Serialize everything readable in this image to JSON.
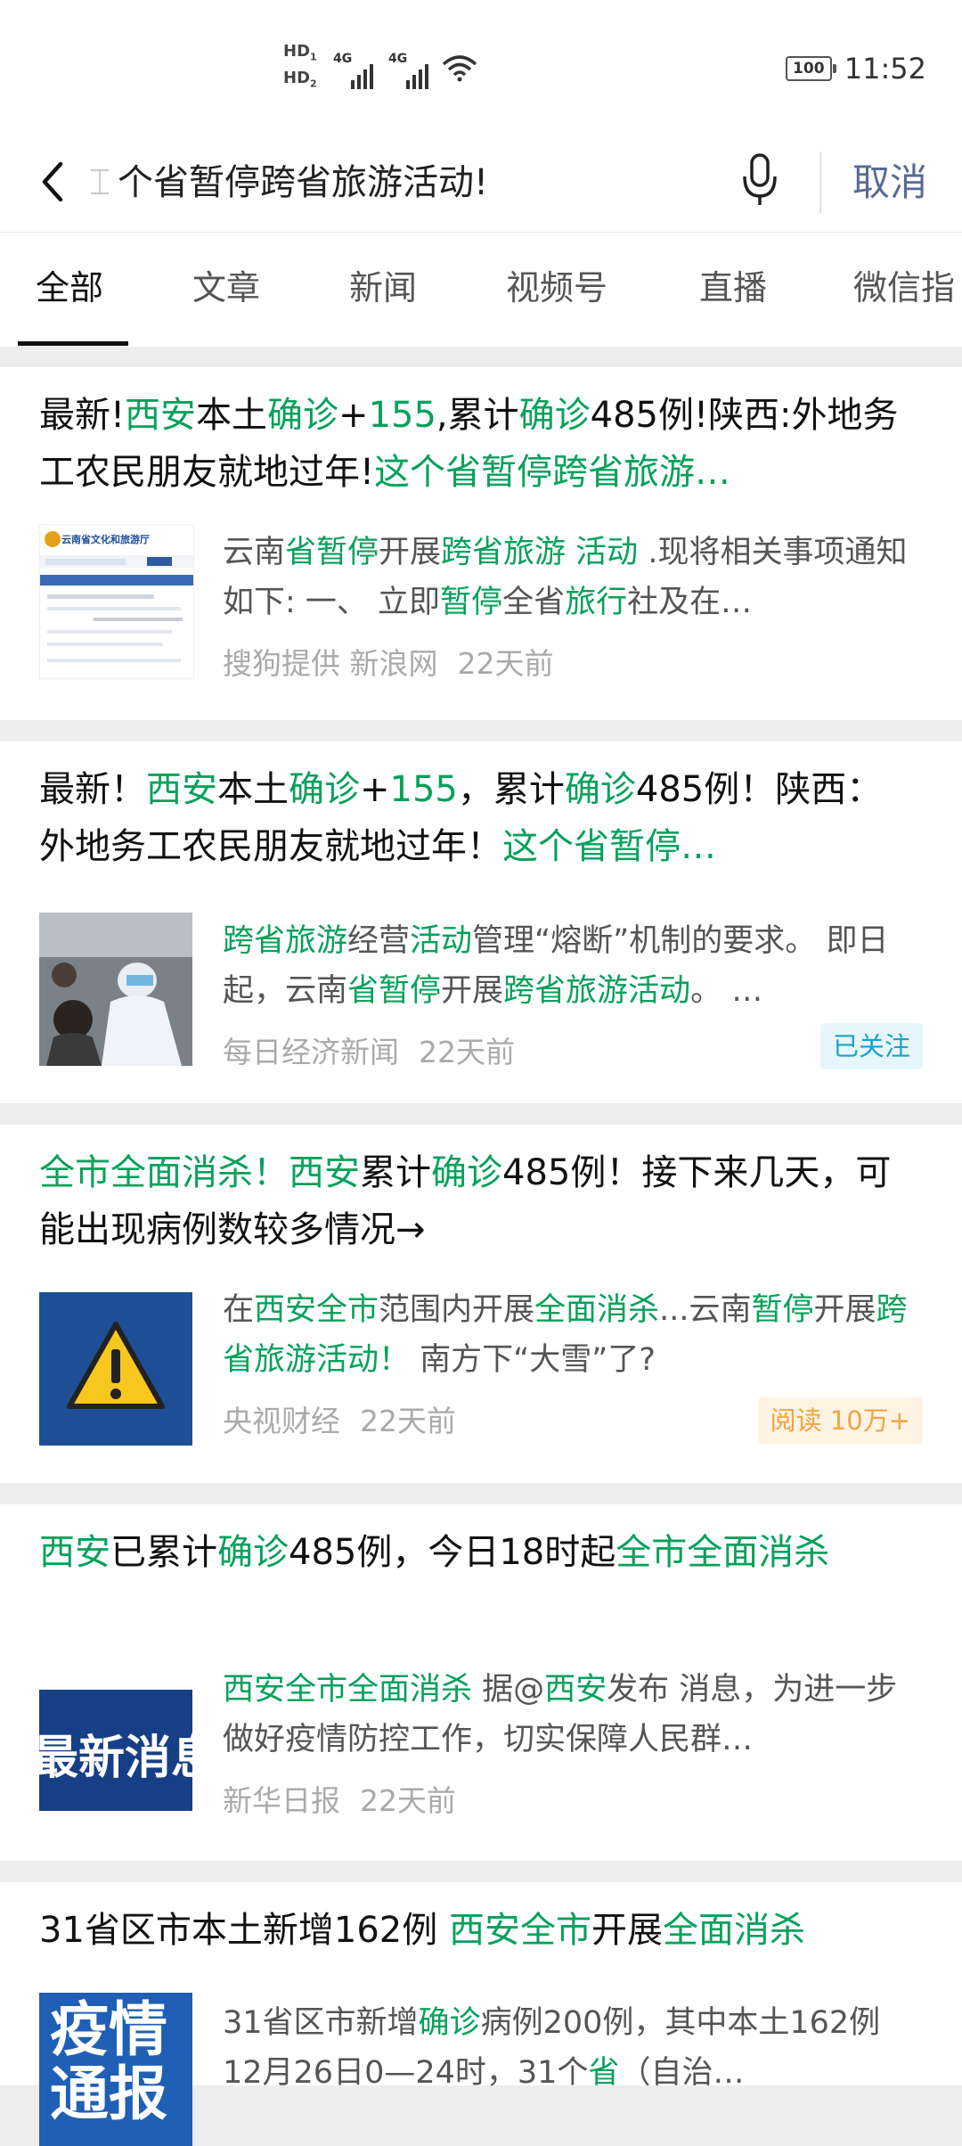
{
  "status_bar": {
    "hd1": "HD",
    "hd1_sub": "1",
    "hd2": "HD",
    "hd2_sub": "2",
    "net1": "4G",
    "net2": "4G",
    "battery": "100",
    "time": "11:52"
  },
  "search": {
    "query_text": "个省暂停跨省旅游活动!",
    "cancel_label": "取消"
  },
  "tabs": [
    {
      "label": "全部",
      "active": true
    },
    {
      "label": "文章",
      "active": false
    },
    {
      "label": "新闻",
      "active": false
    },
    {
      "label": "视频号",
      "active": false
    },
    {
      "label": "直播",
      "active": false
    },
    {
      "label": "微信指",
      "active": false
    }
  ],
  "results": [
    {
      "title": [
        {
          "t": "最新!",
          "hl": false
        },
        {
          "t": "西安",
          "hl": true
        },
        {
          "t": "本土",
          "hl": false
        },
        {
          "t": "确诊",
          "hl": true
        },
        {
          "t": "+",
          "hl": false
        },
        {
          "t": "155",
          "hl": true
        },
        {
          "t": ",累计",
          "hl": false
        },
        {
          "t": "确诊",
          "hl": true
        },
        {
          "t": "485例!陕西:外地务工农民朋友就地过年!",
          "hl": false
        },
        {
          "t": "这个省暂停跨省旅游…",
          "hl": true
        }
      ],
      "snippet": [
        {
          "t": "云南",
          "hl": false
        },
        {
          "t": "省暂停",
          "hl": true
        },
        {
          "t": "开展",
          "hl": false
        },
        {
          "t": "跨省旅游 活动",
          "hl": true
        },
        {
          "t": " .现将相关事项通知如下: 一、 立即",
          "hl": false
        },
        {
          "t": "暂停",
          "hl": true
        },
        {
          "t": "全省",
          "hl": false
        },
        {
          "t": "旅行",
          "hl": true
        },
        {
          "t": "社及在…",
          "hl": false
        }
      ],
      "thumb_text": "云南省文化和旅游厅",
      "source": "搜狗提供 新浪网",
      "time": "22天前",
      "tag": ""
    },
    {
      "title": [
        {
          "t": "最新！",
          "hl": false
        },
        {
          "t": "西安",
          "hl": true
        },
        {
          "t": "本土",
          "hl": false
        },
        {
          "t": "确诊",
          "hl": true
        },
        {
          "t": "+",
          "hl": false
        },
        {
          "t": "155",
          "hl": true
        },
        {
          "t": "，累计",
          "hl": false
        },
        {
          "t": "确诊",
          "hl": true
        },
        {
          "t": "485例！陕西：外地务工农民朋友就地过年！",
          "hl": false
        },
        {
          "t": "这个省暂停…",
          "hl": true
        }
      ],
      "snippet": [
        {
          "t": "跨省旅游",
          "hl": true
        },
        {
          "t": "经营",
          "hl": false
        },
        {
          "t": "活动",
          "hl": true
        },
        {
          "t": "管理“熔断”机制的要求。 即日起，云南",
          "hl": false
        },
        {
          "t": "省暂停",
          "hl": true
        },
        {
          "t": "开展",
          "hl": false
        },
        {
          "t": "跨省旅游活动",
          "hl": true
        },
        {
          "t": "。 …",
          "hl": false
        }
      ],
      "thumb_text": "",
      "source": "每日经济新闻",
      "time": "22天前",
      "tag": "已关注"
    },
    {
      "title": [
        {
          "t": "全市全面消杀！",
          "hl": true
        },
        {
          "t": "西安",
          "hl": true
        },
        {
          "t": "累计",
          "hl": false
        },
        {
          "t": "确诊",
          "hl": true
        },
        {
          "t": "485例！接下来几天，可能出现病例数较多情况→",
          "hl": false
        }
      ],
      "snippet": [
        {
          "t": "在",
          "hl": false
        },
        {
          "t": "西安全市",
          "hl": true
        },
        {
          "t": "范围内开展",
          "hl": false
        },
        {
          "t": "全面消杀",
          "hl": true
        },
        {
          "t": "...云南",
          "hl": false
        },
        {
          "t": "暂停",
          "hl": true
        },
        {
          "t": "开展",
          "hl": false
        },
        {
          "t": "跨省旅游活动！",
          "hl": true
        },
        {
          "t": "  南方下“大雪”了?",
          "hl": false
        }
      ],
      "thumb_text": "",
      "source": "央视财经",
      "time": "22天前",
      "tag": "阅读 10万+"
    },
    {
      "title": [
        {
          "t": "西安",
          "hl": true
        },
        {
          "t": "已累计",
          "hl": false
        },
        {
          "t": "确诊",
          "hl": true
        },
        {
          "t": "485例，今日18时起",
          "hl": false
        },
        {
          "t": "全市全面消杀",
          "hl": true
        }
      ],
      "snippet": [
        {
          "t": "西安全市全面消杀",
          "hl": true
        },
        {
          "t": " 据@",
          "hl": false
        },
        {
          "t": "西安",
          "hl": true
        },
        {
          "t": "发布 消息，为进一步做好疫情防控工作，切实保障人民群…",
          "hl": false
        }
      ],
      "thumb_text": "最新消息",
      "source": "新华日报",
      "time": "22天前",
      "tag": ""
    },
    {
      "title": [
        {
          "t": "31省区市本土新增162例 ",
          "hl": false
        },
        {
          "t": "西安全市",
          "hl": true
        },
        {
          "t": "开展",
          "hl": false
        },
        {
          "t": "全面消杀",
          "hl": true
        }
      ],
      "snippet": [
        {
          "t": "31省区市新增",
          "hl": false
        },
        {
          "t": "确诊",
          "hl": true
        },
        {
          "t": "病例200例，其中本土162例 12月26日0—24时，31个",
          "hl": false
        },
        {
          "t": "省",
          "hl": true
        },
        {
          "t": "（自治…",
          "hl": false
        }
      ],
      "thumb_text": "疫情通报",
      "source": "",
      "time": "",
      "tag": ""
    }
  ],
  "colors": {
    "highlight": "#07a15a",
    "cancel": "#576b95",
    "follow_tag": "#1aa2c6",
    "read_tag": "#f4a340",
    "background": "#ededed"
  },
  "icons": {
    "back": "chevron-left-icon",
    "mic": "microphone-icon",
    "warning": "warning-triangle-icon",
    "wifi": "wifi-icon",
    "signal": "cellular-signal-icon",
    "battery": "battery-icon"
  }
}
